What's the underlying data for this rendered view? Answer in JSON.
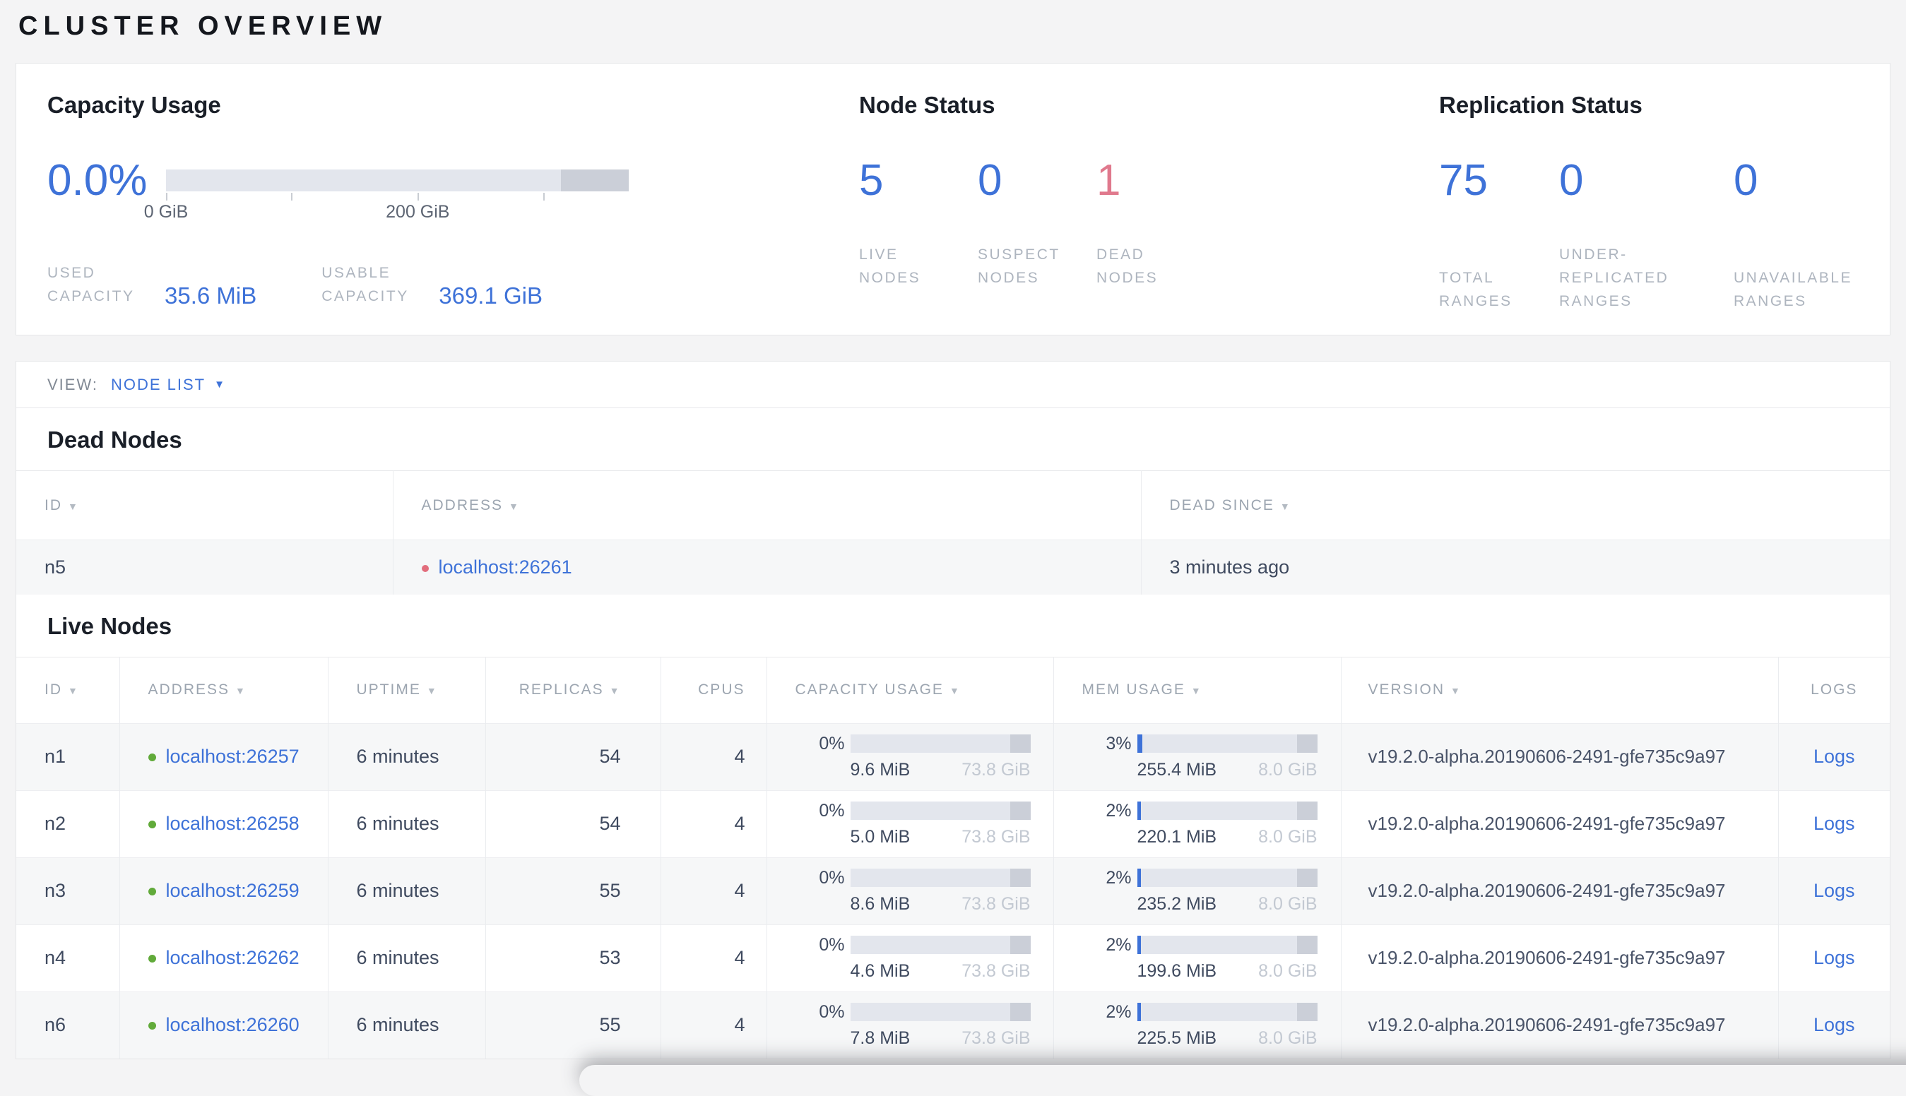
{
  "page": {
    "title": "CLUSTER OVERVIEW"
  },
  "icons": {
    "sort_desc": "▼",
    "dropdown_caret": "▼"
  },
  "colors": {
    "blue": "#3e72d8",
    "red": "#e0798d",
    "green-dot": "#61aa3a",
    "red-dot": "#e26d7c",
    "bar-track": "#e3e6ed",
    "bar-endcap": "#cbcfd8"
  },
  "summary": {
    "capacity": {
      "title": "Capacity Usage",
      "percent": "0.0%",
      "axis_ticks": [
        "0 GiB",
        "200 GiB"
      ],
      "stats": [
        {
          "label": "USED CAPACITY",
          "value": "35.6 MiB"
        },
        {
          "label": "USABLE CAPACITY",
          "value": "369.1 GiB"
        }
      ]
    },
    "node_status": {
      "title": "Node Status",
      "stats": [
        {
          "value": "5",
          "label": "LIVE NODES"
        },
        {
          "value": "0",
          "label": "SUSPECT NODES"
        },
        {
          "value": "1",
          "label": "DEAD NODES"
        }
      ]
    },
    "replication": {
      "title": "Replication Status",
      "stats": [
        {
          "value": "75",
          "label": "TOTAL RANGES"
        },
        {
          "value": "0",
          "label": "UNDER-REPLICATED RANGES"
        },
        {
          "value": "0",
          "label": "UNAVAILABLE RANGES"
        }
      ]
    }
  },
  "view_bar": {
    "label": "VIEW:",
    "selected": "NODE LIST"
  },
  "dead_nodes": {
    "title": "Dead Nodes",
    "columns": [
      {
        "label": "ID"
      },
      {
        "label": "ADDRESS"
      },
      {
        "label": "DEAD SINCE"
      }
    ],
    "rows": [
      {
        "id": "n5",
        "address": "localhost:26261",
        "dead_since": "3 minutes ago"
      }
    ]
  },
  "live_nodes": {
    "title": "Live Nodes",
    "columns": [
      {
        "label": "ID"
      },
      {
        "label": "ADDRESS"
      },
      {
        "label": "UPTIME"
      },
      {
        "label": "REPLICAS"
      },
      {
        "label": "CPUS"
      },
      {
        "label": "CAPACITY USAGE"
      },
      {
        "label": "MEM USAGE"
      },
      {
        "label": "VERSION"
      },
      {
        "label": "LOGS"
      }
    ],
    "rows": [
      {
        "id": "n1",
        "address": "localhost:26257",
        "uptime": "6 minutes",
        "replicas": "54",
        "cpus": "4",
        "capacity": {
          "percent": "0%",
          "used": "9.6 MiB",
          "total": "73.8 GiB"
        },
        "memory": {
          "percent": "3%",
          "used": "255.4 MiB",
          "total": "8.0 GiB"
        },
        "version": "v19.2.0-alpha.20190606-2491-gfe735c9a97",
        "logs_label": "Logs"
      },
      {
        "id": "n2",
        "address": "localhost:26258",
        "uptime": "6 minutes",
        "replicas": "54",
        "cpus": "4",
        "capacity": {
          "percent": "0%",
          "used": "5.0 MiB",
          "total": "73.8 GiB"
        },
        "memory": {
          "percent": "2%",
          "used": "220.1 MiB",
          "total": "8.0 GiB"
        },
        "version": "v19.2.0-alpha.20190606-2491-gfe735c9a97",
        "logs_label": "Logs"
      },
      {
        "id": "n3",
        "address": "localhost:26259",
        "uptime": "6 minutes",
        "replicas": "55",
        "cpus": "4",
        "capacity": {
          "percent": "0%",
          "used": "8.6 MiB",
          "total": "73.8 GiB"
        },
        "memory": {
          "percent": "2%",
          "used": "235.2 MiB",
          "total": "8.0 GiB"
        },
        "version": "v19.2.0-alpha.20190606-2491-gfe735c9a97",
        "logs_label": "Logs"
      },
      {
        "id": "n4",
        "address": "localhost:26262",
        "uptime": "6 minutes",
        "replicas": "53",
        "cpus": "4",
        "capacity": {
          "percent": "0%",
          "used": "4.6 MiB",
          "total": "73.8 GiB"
        },
        "memory": {
          "percent": "2%",
          "used": "199.6 MiB",
          "total": "8.0 GiB"
        },
        "version": "v19.2.0-alpha.20190606-2491-gfe735c9a97",
        "logs_label": "Logs"
      },
      {
        "id": "n6",
        "address": "localhost:26260",
        "uptime": "6 minutes",
        "replicas": "55",
        "cpus": "4",
        "capacity": {
          "percent": "0%",
          "used": "7.8 MiB",
          "total": "73.8 GiB"
        },
        "memory": {
          "percent": "2%",
          "used": "225.5 MiB",
          "total": "8.0 GiB"
        },
        "version": "v19.2.0-alpha.20190606-2491-gfe735c9a97",
        "logs_label": "Logs"
      }
    ]
  }
}
